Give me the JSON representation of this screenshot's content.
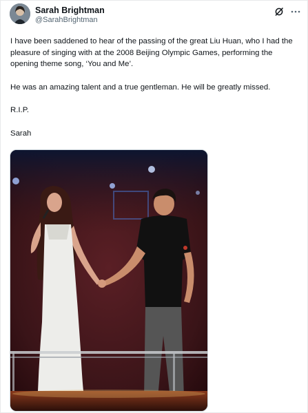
{
  "author": {
    "display_name": "Sarah Brightman",
    "handle": "@SarahBrightman"
  },
  "icons": {
    "grok": "grok-icon",
    "more": "more-icon"
  },
  "post": {
    "paragraphs": [
      "I have been saddened to hear of the passing of the great Liu Huan, who I had the pleasure of singing with at the 2008 Beijing Olympic Games, performing the opening theme song, ‘You and Me’.",
      "He was an amazing talent and a true gentleman. He will be greatly missed.",
      "R.I.P.",
      "Sarah"
    ]
  },
  "colors": {
    "text": "#0f1419",
    "secondary": "#536471",
    "stage_dark": "#3a1418"
  }
}
